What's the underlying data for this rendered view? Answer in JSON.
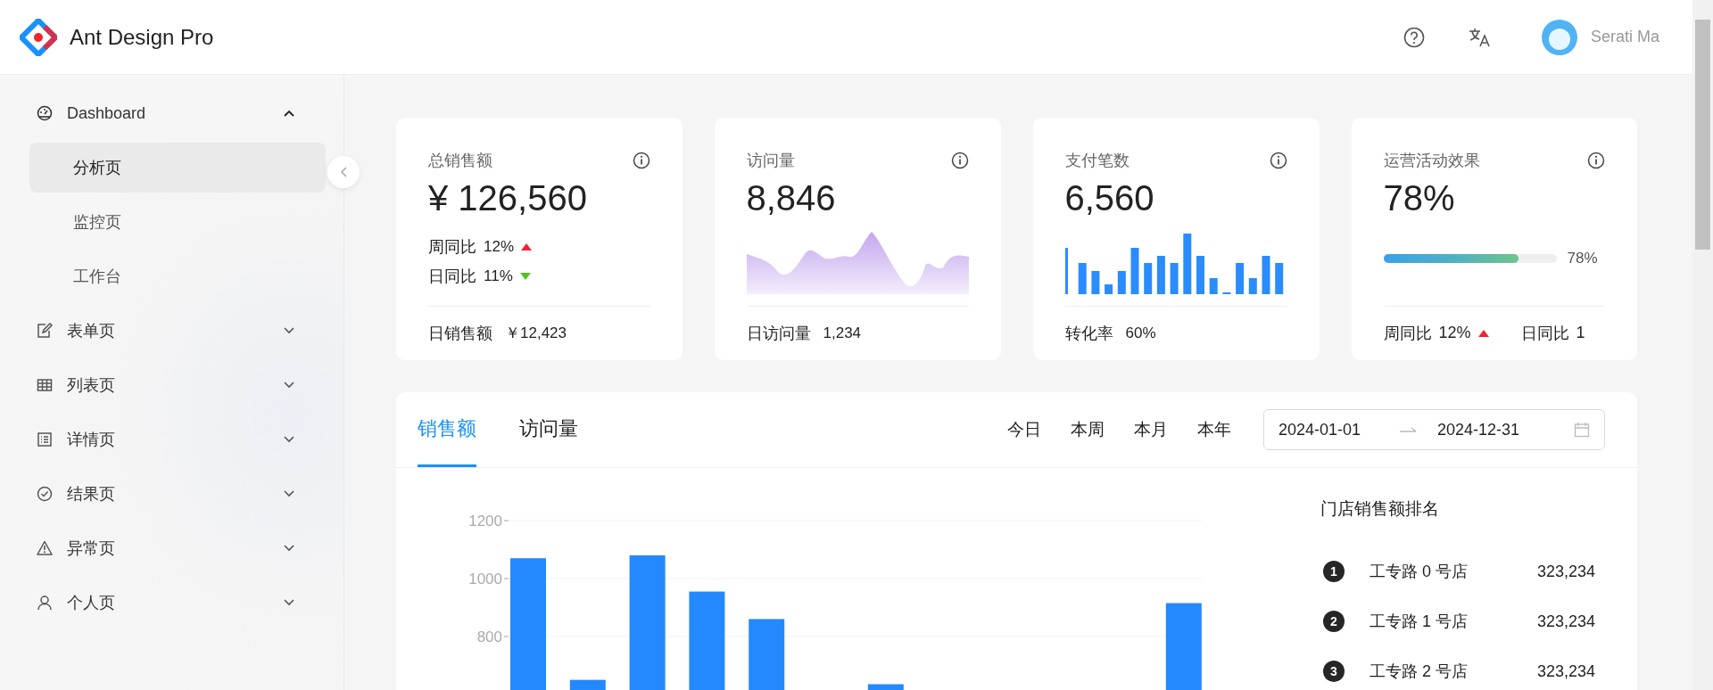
{
  "header": {
    "title": "Ant Design Pro",
    "user": "Serati Ma"
  },
  "sidebar": {
    "items": [
      {
        "label": "Dashboard",
        "kind": "dashboard",
        "expanded": true,
        "children": [
          {
            "label": "分析页",
            "selected": true
          },
          {
            "label": "监控页",
            "selected": false
          },
          {
            "label": "工作台",
            "selected": false
          }
        ]
      },
      {
        "label": "表单页",
        "kind": "form",
        "expanded": false
      },
      {
        "label": "列表页",
        "kind": "table",
        "expanded": false
      },
      {
        "label": "详情页",
        "kind": "profile",
        "expanded": false
      },
      {
        "label": "结果页",
        "kind": "result",
        "expanded": false
      },
      {
        "label": "异常页",
        "kind": "warning",
        "expanded": false
      },
      {
        "label": "个人页",
        "kind": "user",
        "expanded": false
      }
    ]
  },
  "stat_cards": [
    {
      "kind": "trend",
      "title": "总销售额",
      "value": "¥ 126,560",
      "trends": [
        {
          "label": "周同比",
          "value": "12%",
          "rising": true
        },
        {
          "label": "日同比",
          "value": "11%",
          "rising": false
        }
      ],
      "footer_label": "日销售额",
      "footer_value": "￥12,423"
    },
    {
      "kind": "area",
      "title": "访问量",
      "value": "8,846",
      "footer_label": "日访问量",
      "footer_value": "1,234"
    },
    {
      "kind": "bars",
      "title": "支付笔数",
      "value": "6,560",
      "footer_label": "转化率",
      "footer_value": "60%"
    },
    {
      "kind": "progress",
      "title": "运营活动效果",
      "value": "78%",
      "level": 0.78,
      "reading": "78%",
      "trends": [
        {
          "label": "周同比",
          "value": "12%",
          "rising": true
        },
        {
          "label": "日同比",
          "value": "1"
        }
      ]
    }
  ],
  "sales": {
    "tabs": [
      {
        "label": "销售额",
        "selected": true
      },
      {
        "label": "访问量",
        "selected": false
      }
    ],
    "ranges": [
      "今日",
      "本周",
      "本月",
      "本年"
    ],
    "date_range": {
      "start": "2024-01-01",
      "end": "2024-12-31"
    },
    "chart_data": {
      "type": "bar",
      "ylim": [
        615,
        1200
      ],
      "yticks": [
        800,
        1000,
        1200
      ],
      "values": [
        1070,
        650,
        1080,
        955,
        860,
        null,
        635,
        null,
        null,
        null,
        null,
        915
      ]
    },
    "ranking": {
      "title": "门店销售额排名",
      "items": [
        {
          "rank": "1",
          "name": "工专路 0 号店",
          "value": "323,234"
        },
        {
          "rank": "2",
          "name": "工专路 1 号店",
          "value": "323,234"
        },
        {
          "rank": "3",
          "name": "工专路 2 号店",
          "value": "323,234"
        }
      ]
    }
  }
}
